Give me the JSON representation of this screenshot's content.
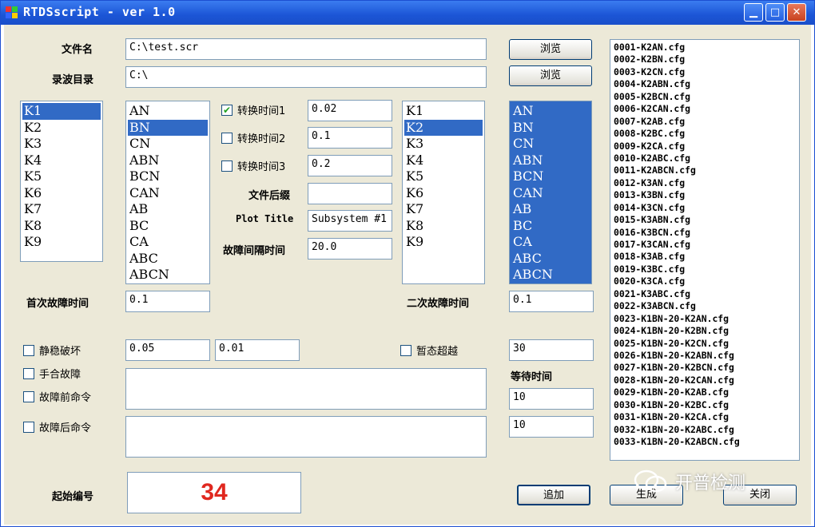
{
  "window": {
    "title": "RTDSscript  - ver 1.0"
  },
  "fields": {
    "filename_label": "文件名",
    "filename_value": "C:\\test.scr",
    "record_dir_label": "录波目录",
    "record_dir_value": "C:\\",
    "browse_label": "浏览"
  },
  "lists": {
    "k_items": [
      "K1",
      "K2",
      "K3",
      "K4",
      "K5",
      "K6",
      "K7",
      "K8",
      "K9"
    ],
    "phase_items": [
      "AN",
      "BN",
      "CN",
      "ABN",
      "BCN",
      "CAN",
      "AB",
      "BC",
      "CA",
      "ABC",
      "ABCN"
    ]
  },
  "conversion": {
    "time1_label": "转换时间1",
    "time1_value": "0.02",
    "time2_label": "转换时间2",
    "time2_value": "0.1",
    "time3_label": "转换时间3",
    "time3_value": "0.2",
    "suffix_label": "文件后缀",
    "suffix_value": "",
    "plot_title_label": "Plot Title",
    "plot_title_value": "Subsystem #1",
    "fault_interval_label": "故障间隔时间",
    "fault_interval_value": "20.0"
  },
  "fault_times": {
    "first_label": "首次故障时间",
    "first_value": "0.1",
    "second_label": "二次故障时间",
    "second_value": "0.1"
  },
  "options": {
    "static_label": "静稳破坏",
    "static_value1": "0.05",
    "static_value2": "0.01",
    "transient_label": "暂态超越",
    "transient_value": "30",
    "manual_label": "手合故障",
    "wait_label": "等待时间",
    "pre_cmd_label": "故障前命令",
    "pre_cmd_value": "10",
    "post_cmd_label": "故障后命令",
    "post_cmd_value": "10"
  },
  "output": {
    "files": [
      "0001-K2AN.cfg",
      "0002-K2BN.cfg",
      "0003-K2CN.cfg",
      "0004-K2ABN.cfg",
      "0005-K2BCN.cfg",
      "0006-K2CAN.cfg",
      "0007-K2AB.cfg",
      "0008-K2BC.cfg",
      "0009-K2CA.cfg",
      "0010-K2ABC.cfg",
      "0011-K2ABCN.cfg",
      "0012-K3AN.cfg",
      "0013-K3BN.cfg",
      "0014-K3CN.cfg",
      "0015-K3ABN.cfg",
      "0016-K3BCN.cfg",
      "0017-K3CAN.cfg",
      "0018-K3AB.cfg",
      "0019-K3BC.cfg",
      "0020-K3CA.cfg",
      "0021-K3ABC.cfg",
      "0022-K3ABCN.cfg",
      "0023-K1BN-20-K2AN.cfg",
      "0024-K1BN-20-K2BN.cfg",
      "0025-K1BN-20-K2CN.cfg",
      "0026-K1BN-20-K2ABN.cfg",
      "0027-K1BN-20-K2BCN.cfg",
      "0028-K1BN-20-K2CAN.cfg",
      "0029-K1BN-20-K2AB.cfg",
      "0030-K1BN-20-K2BC.cfg",
      "0031-K1BN-20-K2CA.cfg",
      "0032-K1BN-20-K2ABC.cfg",
      "0033-K1BN-20-K2ABCN.cfg"
    ],
    "start_no_label": "起始编号",
    "start_no_value": "34",
    "add_label": "追加",
    "generate_label": "生成",
    "close_label": "关闭"
  },
  "watermark": {
    "text": "开普检测"
  },
  "colors": {
    "selection": "#316ac5",
    "start_number": "#e0281f",
    "titlebar": "#1b55d6"
  }
}
